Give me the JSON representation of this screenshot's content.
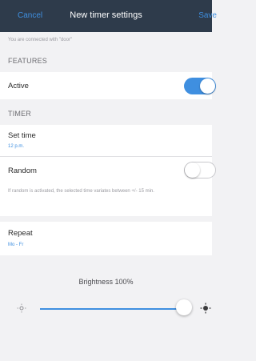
{
  "nav": {
    "cancel": "Cancel",
    "title": "New timer settings",
    "save": "Save"
  },
  "info_text": "You are connected with \"door\"",
  "features": {
    "header": "FEATURES",
    "active": {
      "label": "Active",
      "state": "on"
    }
  },
  "timer": {
    "header": "TIMER",
    "set_time": {
      "label": "Set time",
      "value": "12 p.m."
    },
    "random": {
      "label": "Random",
      "state": "off"
    },
    "random_note": "If random is activated, the selected time variates between +/- 15 min.",
    "repeat": {
      "label": "Repeat",
      "value": "Mo - Fr"
    }
  },
  "brightness": {
    "label": "Brightness 100%",
    "level": 1.0
  },
  "colors": {
    "accent": "#3f8fe0",
    "navbar": "#2e3b4b",
    "background": "#f2f2f4"
  },
  "icons": {
    "slider_min": "sun-small-icon",
    "slider_max": "sun-large-icon"
  }
}
